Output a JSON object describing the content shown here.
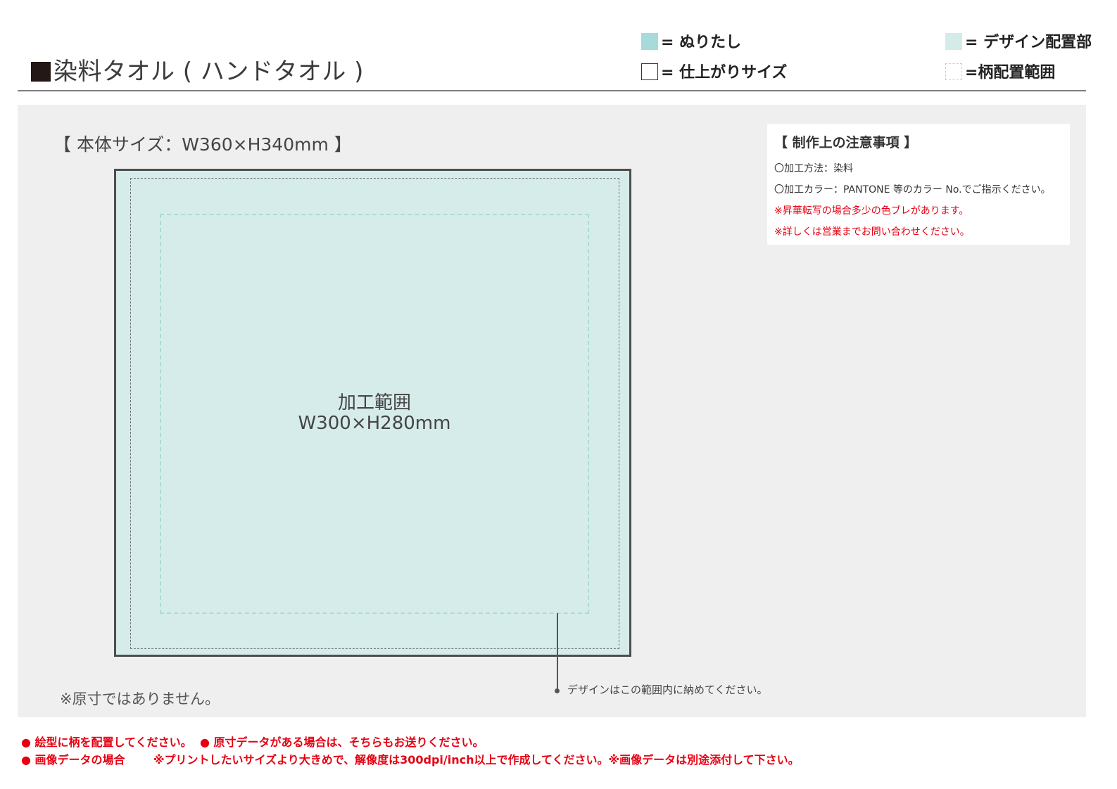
{
  "header": {
    "title": "染料タオル ( ハンドタオル )",
    "legend": {
      "bleed": "= ぬりたし",
      "trim": "= 仕上がりサイズ",
      "design": "= デザイン配置部",
      "pattern": "=柄配置範囲"
    }
  },
  "template": {
    "body_size": "【 本体サイズ：W360×H340mm 】",
    "area_title": "加工範囲",
    "area_size": "W300×H280mm",
    "design_note": "デザインはこの範囲内に納めてください。",
    "not_actual_size": "※原寸ではありません。"
  },
  "notes": {
    "title": "【 制作上の注意事項 】",
    "lines": [
      "〇加工方法：染料",
      "〇加工カラー：PANTONE 等のカラー No.でご指示ください。",
      "※昇華転写の場合多少の色ブレがあります。",
      "※詳しくは営業までお問い合わせください。"
    ]
  },
  "footer": {
    "line1a": "● 絵型に柄を配置してください。",
    "line1b": "● 原寸データがある場合は、そちらもお送りください。",
    "line2a": "● 画像データの場合",
    "line2b": "※プリントしたいサイズより大きめで、解像度は300dpi/inch以上で作成してください。※画像データは別途添付して下さい。"
  },
  "colors": {
    "bleed": "#a7dada",
    "design_area": "#d6ecea",
    "panel": "#eeefee",
    "warning": "#e60012"
  }
}
